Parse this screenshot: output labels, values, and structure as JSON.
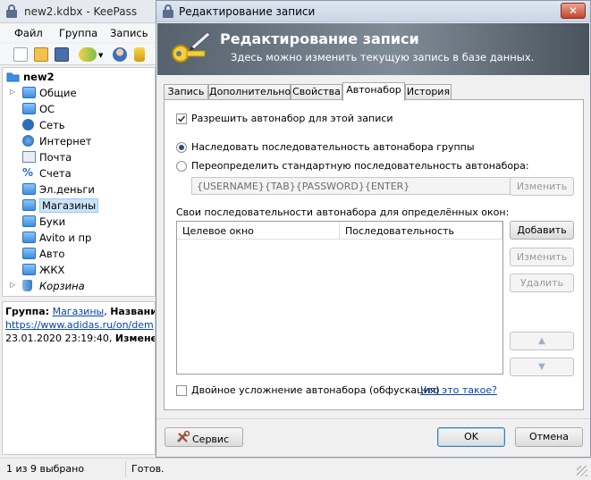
{
  "main_window": {
    "title": "new2.kdbx - KeePass",
    "menu": [
      "Файл",
      "Группа",
      "Запись"
    ],
    "tree": {
      "root": "new2",
      "groups": [
        "Общие",
        "ОС",
        "Сеть",
        "Интернет",
        "Почта",
        "Счета",
        "Эл.деньги",
        "Магазины",
        "Буки",
        "Avito и пр",
        "Авто",
        "ЖКХ",
        "Корзина"
      ],
      "selected": "Магазины"
    },
    "details": {
      "group_label": "Группа:",
      "group_value": "Магазины",
      "separator": ",",
      "name_label": "Название:",
      "url": "https://www.adidas.ru/on/dem",
      "created": "23.01.2020 23:19:40,",
      "modified_label": "Изменено:"
    },
    "status": {
      "selection": "1 из 9 выбрано",
      "state": "Готов."
    }
  },
  "dialog": {
    "title": "Редактирование записи",
    "close": "✕",
    "banner_title": "Редактирование записи",
    "banner_subtitle": "Здесь можно изменить текущую запись в базе данных.",
    "tabs": [
      "Запись",
      "Дополнительно",
      "Свойства",
      "Автонабор",
      "История"
    ],
    "active_tab": "Автонабор",
    "enable_autotype": {
      "label": "Разрешить автонабор для этой записи",
      "checked": true
    },
    "inherit_radio": {
      "label": "Наследовать последовательность автонабора группы",
      "selected": true
    },
    "override_radio": {
      "label": "Переопределить стандартную последовательность автонабора:",
      "selected": false
    },
    "sequence_value": "{USERNAME}{TAB}{PASSWORD}{ENTER}",
    "edit_sequence_button": "Изменить",
    "windows_label": "Свои последовательности автонабора для определённых окон:",
    "table_headers": [
      "Целевое окно",
      "Последовательность"
    ],
    "buttons": {
      "add": "Добавить",
      "edit": "Изменить",
      "delete": "Удалить",
      "up": "▲",
      "down": "▼"
    },
    "obfuscation": {
      "label": "Двойное усложнение автонабора (обфускация)",
      "checked": false
    },
    "help_link": "Что это такое?",
    "service_button": "Сервис",
    "ok_button": "OK",
    "cancel_button": "Отмена"
  },
  "colors": {
    "link": "#0645ad",
    "banner": "#6b7782",
    "selection": "#cce4f7"
  }
}
